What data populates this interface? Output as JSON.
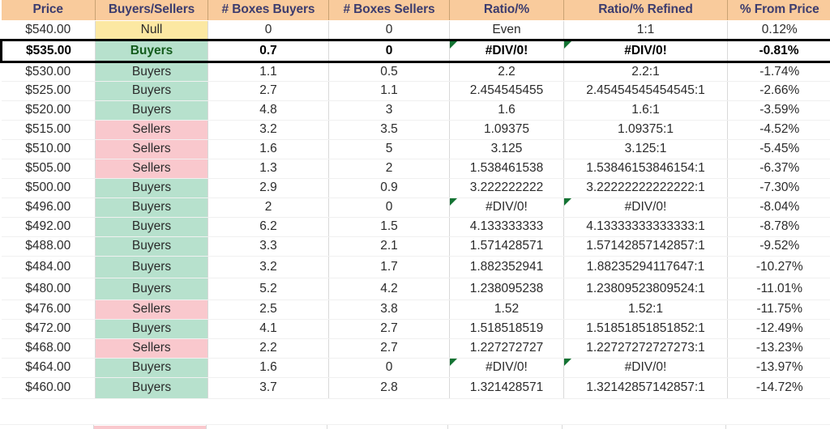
{
  "table": {
    "columns": [
      "Price",
      "Buyers/Sellers",
      "# Boxes Buyers",
      "# Boxes Sellers",
      "Ratio/%",
      "Ratio/% Refined",
      "% From Price"
    ],
    "colors": {
      "header_fill": "#f9cb9c",
      "header_text": "#3c3c6e",
      "buyers_fill": "#b7e1cd",
      "buyers_text": "#1d6b26",
      "sellers_fill": "#f9c8cd",
      "sellers_text": "#cc2244",
      "null_fill": "#fce8a2",
      "null_text": "#8a6d20",
      "error_flag": "#137333",
      "selected_border": "#000000",
      "gridline": "#d9d9d9"
    },
    "rows": [
      {
        "price": "$540.00",
        "side": "Null",
        "side_kind": "null",
        "boxes_buyers": "0",
        "boxes_sellers": "0",
        "ratio": "Even",
        "ratio_refined": "1:1",
        "pct_from_price": "0.12%",
        "ratio_error": false,
        "selected": false,
        "tall": false
      },
      {
        "price": "$535.00",
        "side": "Buyers",
        "side_kind": "buyers",
        "boxes_buyers": "0.7",
        "boxes_sellers": "0",
        "ratio": "#DIV/0!",
        "ratio_refined": "#DIV/0!",
        "pct_from_price": "-0.81%",
        "ratio_error": true,
        "selected": true,
        "tall": false
      },
      {
        "price": "$530.00",
        "side": "Buyers",
        "side_kind": "buyers",
        "boxes_buyers": "1.1",
        "boxes_sellers": "0.5",
        "ratio": "2.2",
        "ratio_refined": "2.2:1",
        "pct_from_price": "-1.74%",
        "ratio_error": false,
        "selected": false,
        "tall": false
      },
      {
        "price": "$525.00",
        "side": "Buyers",
        "side_kind": "buyers",
        "boxes_buyers": "2.7",
        "boxes_sellers": "1.1",
        "ratio": "2.454545455",
        "ratio_refined": "2.45454545454545:1",
        "pct_from_price": "-2.66%",
        "ratio_error": false,
        "selected": false,
        "tall": false
      },
      {
        "price": "$520.00",
        "side": "Buyers",
        "side_kind": "buyers",
        "boxes_buyers": "4.8",
        "boxes_sellers": "3",
        "ratio": "1.6",
        "ratio_refined": "1.6:1",
        "pct_from_price": "-3.59%",
        "ratio_error": false,
        "selected": false,
        "tall": false
      },
      {
        "price": "$515.00",
        "side": "Sellers",
        "side_kind": "sellers",
        "boxes_buyers": "3.2",
        "boxes_sellers": "3.5",
        "ratio": "1.09375",
        "ratio_refined": "1.09375:1",
        "pct_from_price": "-4.52%",
        "ratio_error": false,
        "selected": false,
        "tall": false
      },
      {
        "price": "$510.00",
        "side": "Sellers",
        "side_kind": "sellers",
        "boxes_buyers": "1.6",
        "boxes_sellers": "5",
        "ratio": "3.125",
        "ratio_refined": "3.125:1",
        "pct_from_price": "-5.45%",
        "ratio_error": false,
        "selected": false,
        "tall": false
      },
      {
        "price": "$505.00",
        "side": "Sellers",
        "side_kind": "sellers",
        "boxes_buyers": "1.3",
        "boxes_sellers": "2",
        "ratio": "1.538461538",
        "ratio_refined": "1.53846153846154:1",
        "pct_from_price": "-6.37%",
        "ratio_error": false,
        "selected": false,
        "tall": false
      },
      {
        "price": "$500.00",
        "side": "Buyers",
        "side_kind": "buyers",
        "boxes_buyers": "2.9",
        "boxes_sellers": "0.9",
        "ratio": "3.222222222",
        "ratio_refined": "3.22222222222222:1",
        "pct_from_price": "-7.30%",
        "ratio_error": false,
        "selected": false,
        "tall": false
      },
      {
        "price": "$496.00",
        "side": "Buyers",
        "side_kind": "buyers",
        "boxes_buyers": "2",
        "boxes_sellers": "0",
        "ratio": "#DIV/0!",
        "ratio_refined": "#DIV/0!",
        "pct_from_price": "-8.04%",
        "ratio_error": true,
        "selected": false,
        "tall": false
      },
      {
        "price": "$492.00",
        "side": "Buyers",
        "side_kind": "buyers",
        "boxes_buyers": "6.2",
        "boxes_sellers": "1.5",
        "ratio": "4.133333333",
        "ratio_refined": "4.13333333333333:1",
        "pct_from_price": "-8.78%",
        "ratio_error": false,
        "selected": false,
        "tall": false
      },
      {
        "price": "$488.00",
        "side": "Buyers",
        "side_kind": "buyers",
        "boxes_buyers": "3.3",
        "boxes_sellers": "2.1",
        "ratio": "1.571428571",
        "ratio_refined": "1.57142857142857:1",
        "pct_from_price": "-9.52%",
        "ratio_error": false,
        "selected": false,
        "tall": false
      },
      {
        "price": "$484.00",
        "side": "Buyers",
        "side_kind": "buyers",
        "boxes_buyers": "3.2",
        "boxes_sellers": "1.7",
        "ratio": "1.882352941",
        "ratio_refined": "1.88235294117647:1",
        "pct_from_price": "-10.27%",
        "ratio_error": false,
        "selected": false,
        "tall": true
      },
      {
        "price": "$480.00",
        "side": "Buyers",
        "side_kind": "buyers",
        "boxes_buyers": "5.2",
        "boxes_sellers": "4.2",
        "ratio": "1.238095238",
        "ratio_refined": "1.23809523809524:1",
        "pct_from_price": "-11.01%",
        "ratio_error": false,
        "selected": false,
        "tall": true
      },
      {
        "price": "$476.00",
        "side": "Sellers",
        "side_kind": "sellers",
        "boxes_buyers": "2.5",
        "boxes_sellers": "3.8",
        "ratio": "1.52",
        "ratio_refined": "1.52:1",
        "pct_from_price": "-11.75%",
        "ratio_error": false,
        "selected": false,
        "tall": false
      },
      {
        "price": "$472.00",
        "side": "Buyers",
        "side_kind": "buyers",
        "boxes_buyers": "4.1",
        "boxes_sellers": "2.7",
        "ratio": "1.518518519",
        "ratio_refined": "1.51851851851852:1",
        "pct_from_price": "-12.49%",
        "ratio_error": false,
        "selected": false,
        "tall": false
      },
      {
        "price": "$468.00",
        "side": "Sellers",
        "side_kind": "sellers",
        "boxes_buyers": "2.2",
        "boxes_sellers": "2.7",
        "ratio": "1.227272727",
        "ratio_refined": "1.22727272727273:1",
        "pct_from_price": "-13.23%",
        "ratio_error": false,
        "selected": false,
        "tall": false
      },
      {
        "price": "$464.00",
        "side": "Buyers",
        "side_kind": "buyers",
        "boxes_buyers": "1.6",
        "boxes_sellers": "0",
        "ratio": "#DIV/0!",
        "ratio_refined": "#DIV/0!",
        "pct_from_price": "-13.97%",
        "ratio_error": true,
        "selected": false,
        "tall": false
      },
      {
        "price": "$460.00",
        "side": "Buyers",
        "side_kind": "buyers",
        "boxes_buyers": "3.7",
        "boxes_sellers": "2.8",
        "ratio": "1.321428571",
        "ratio_refined": "1.32142857142857:1",
        "pct_from_price": "-14.72%",
        "ratio_error": false,
        "selected": false,
        "tall": false
      }
    ]
  }
}
